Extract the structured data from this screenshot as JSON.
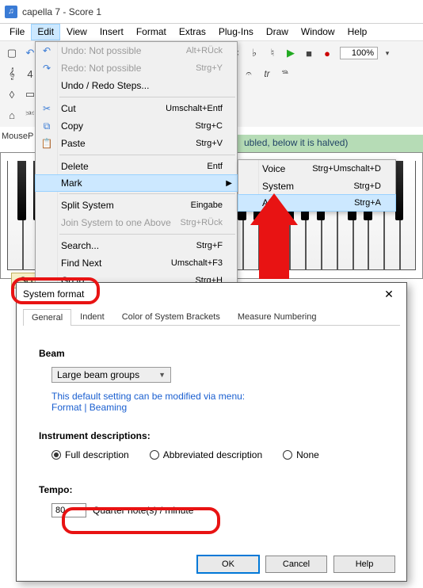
{
  "window": {
    "title": "capella 7 - Score 1"
  },
  "menubar": {
    "items": [
      "File",
      "Edit",
      "View",
      "Insert",
      "Format",
      "Extras",
      "Plug-Ins",
      "Draw",
      "Window",
      "Help"
    ],
    "open_index": 1
  },
  "zoom": {
    "value": "100%"
  },
  "edit_menu": [
    {
      "label": "Undo: Not possible",
      "shortcut": "Alt+RÜck",
      "disabled": true,
      "icon": "↶"
    },
    {
      "label": "Redo: Not possible",
      "shortcut": "Strg+Y",
      "disabled": true,
      "icon": "↷"
    },
    {
      "label": "Undo / Redo Steps...",
      "shortcut": "",
      "disabled": false
    },
    {
      "sep": true
    },
    {
      "label": "Cut",
      "shortcut": "Umschalt+Entf",
      "icon": "✂"
    },
    {
      "label": "Copy",
      "shortcut": "Strg+C",
      "icon": "⧉"
    },
    {
      "label": "Paste",
      "shortcut": "Strg+V",
      "icon": "📋"
    },
    {
      "sep": true
    },
    {
      "label": "Delete",
      "shortcut": "Entf"
    },
    {
      "label": "Mark",
      "shortcut": "",
      "submenu": true,
      "highlight": true
    },
    {
      "sep": true
    },
    {
      "label": "Split System",
      "shortcut": "Eingabe"
    },
    {
      "label": "Join System to one Above",
      "shortcut": "Strg+RÜck",
      "disabled": true
    },
    {
      "sep": true
    },
    {
      "label": "Search...",
      "shortcut": "Strg+F"
    },
    {
      "label": "Find Next",
      "shortcut": "Umschalt+F3"
    },
    {
      "label": "Go to...",
      "shortcut": "Strg+H"
    }
  ],
  "mark_submenu": [
    {
      "label": "Voice",
      "shortcut": "Strg+Umschalt+D"
    },
    {
      "label": "System",
      "shortcut": "Strg+D"
    },
    {
      "label": "All",
      "shortcut": "Strg+A",
      "highlight": true
    }
  ],
  "infobar": {
    "text": "ubled, below it is halved)"
  },
  "score_tab": {
    "label": "Score 1",
    "close": "✕"
  },
  "mouse_panel": {
    "label": "MouseP"
  },
  "dialog": {
    "title": "System format",
    "close": "✕",
    "tabs": [
      "General",
      "Indent",
      "Color of System Brackets",
      "Measure Numbering"
    ],
    "active_tab": 0,
    "beam": {
      "label": "Beam",
      "combo_value": "Large beam groups",
      "hint_line1": "This default setting can be modified via menu:",
      "hint_line2": "Format | Beaming"
    },
    "instrument": {
      "label": "Instrument descriptions:",
      "options": [
        "Full description",
        "Abbreviated description",
        "None"
      ],
      "selected": 0
    },
    "tempo": {
      "label": "Tempo:",
      "value": "80",
      "unit": "Quarter note(s) / minute"
    },
    "buttons": {
      "ok": "OK",
      "cancel": "Cancel",
      "help": "Help"
    }
  }
}
